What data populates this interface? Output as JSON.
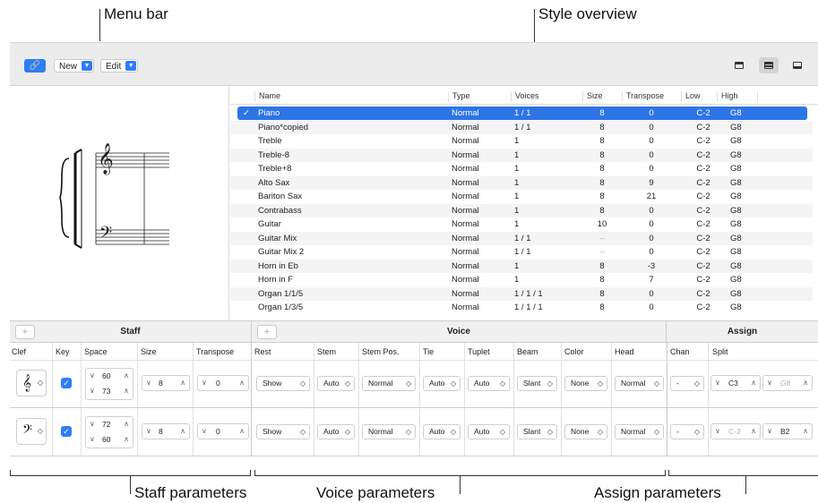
{
  "callouts": {
    "menu_bar": "Menu bar",
    "style_overview": "Style overview",
    "staff_parameters": "Staff parameters",
    "voice_parameters": "Voice parameters",
    "assign_parameters": "Assign parameters"
  },
  "toolbar": {
    "link_icon": "link-icon",
    "new_label": "New",
    "edit_label": "Edit"
  },
  "preview": {
    "treble_clef": "𝄞",
    "bass_clef": "𝄢"
  },
  "list": {
    "columns": [
      "Name",
      "Type",
      "Voices",
      "Size",
      "Transpose",
      "Low",
      "High"
    ],
    "rows": [
      {
        "check": "✓",
        "name": "Piano",
        "type": "Normal",
        "voices": "1 / 1",
        "size": "8",
        "transpose": "0",
        "low": "C-2",
        "high": "G8"
      },
      {
        "check": "",
        "name": "Piano*copied",
        "type": "Normal",
        "voices": "1 / 1",
        "size": "8",
        "transpose": "0",
        "low": "C-2",
        "high": "G8"
      },
      {
        "check": "",
        "name": "Treble",
        "type": "Normal",
        "voices": "1",
        "size": "8",
        "transpose": "0",
        "low": "C-2",
        "high": "G8"
      },
      {
        "check": "",
        "name": "Treble-8",
        "type": "Normal",
        "voices": "1",
        "size": "8",
        "transpose": "0",
        "low": "C-2",
        "high": "G8"
      },
      {
        "check": "",
        "name": "Treble+8",
        "type": "Normal",
        "voices": "1",
        "size": "8",
        "transpose": "0",
        "low": "C-2",
        "high": "G8"
      },
      {
        "check": "",
        "name": "Alto Sax",
        "type": "Normal",
        "voices": "1",
        "size": "8",
        "transpose": "9",
        "low": "C-2",
        "high": "G8"
      },
      {
        "check": "",
        "name": "Bariton Sax",
        "type": "Normal",
        "voices": "1",
        "size": "8",
        "transpose": "21",
        "low": "C-2",
        "high": "G8"
      },
      {
        "check": "",
        "name": "Contrabass",
        "type": "Normal",
        "voices": "1",
        "size": "8",
        "transpose": "0",
        "low": "C-2",
        "high": "G8"
      },
      {
        "check": "",
        "name": "Guitar",
        "type": "Normal",
        "voices": "1",
        "size": "10",
        "transpose": "0",
        "low": "C-2",
        "high": "G8"
      },
      {
        "check": "",
        "name": "Guitar Mix",
        "type": "Normal",
        "voices": "1 / 1",
        "size": "–",
        "transpose": "0",
        "low": "C-2",
        "high": "G8"
      },
      {
        "check": "",
        "name": "Guitar Mix 2",
        "type": "Normal",
        "voices": "1 / 1",
        "size": "–",
        "transpose": "0",
        "low": "C-2",
        "high": "G8"
      },
      {
        "check": "",
        "name": "Horn in Eb",
        "type": "Normal",
        "voices": "1",
        "size": "8",
        "transpose": "-3",
        "low": "C-2",
        "high": "G8"
      },
      {
        "check": "",
        "name": "Horn in F",
        "type": "Normal",
        "voices": "1",
        "size": "8",
        "transpose": "7",
        "low": "C-2",
        "high": "G8"
      },
      {
        "check": "",
        "name": "Organ 1/1/5",
        "type": "Normal",
        "voices": "1 / 1 / 1",
        "size": "8",
        "transpose": "0",
        "low": "C-2",
        "high": "G8"
      },
      {
        "check": "",
        "name": "Organ 1/3/5",
        "type": "Normal",
        "voices": "1 / 1 / 1",
        "size": "8",
        "transpose": "0",
        "low": "C-2",
        "high": "G8"
      }
    ]
  },
  "params": {
    "plus": "+",
    "staff_title": "Staff",
    "voice_title": "Voice",
    "assign_title": "Assign",
    "col_labels": {
      "clef": "Clef",
      "key": "Key",
      "space": "Space",
      "size": "Size",
      "transpose": "Transpose",
      "rest": "Rest",
      "stem": "Stem",
      "stem_pos": "Stem Pos.",
      "tie": "Tie",
      "tuplet": "Tuplet",
      "beam": "Beam",
      "color": "Color",
      "head": "Head",
      "chan": "Chan",
      "split": "Split"
    },
    "rows": [
      {
        "clef": "𝄞",
        "key_check": "✓",
        "space_top": "60",
        "space_bottom": "73",
        "size": "8",
        "transpose": "0",
        "rest": "Show",
        "stem": "Auto",
        "stem_pos": "Normal",
        "tie": "Auto",
        "tuplet": "Auto",
        "beam": "Slant",
        "color": "None",
        "head": "Normal",
        "chan": "-",
        "split_left": "C3",
        "split_right": "G8"
      },
      {
        "clef": "𝄢",
        "key_check": "✓",
        "space_top": "72",
        "space_bottom": "60",
        "size": "8",
        "transpose": "0",
        "rest": "Show",
        "stem": "Auto",
        "stem_pos": "Normal",
        "tie": "Auto",
        "tuplet": "Auto",
        "beam": "Slant",
        "color": "None",
        "head": "Normal",
        "chan": "-",
        "split_left": "C-2",
        "split_right": "B2"
      }
    ]
  }
}
